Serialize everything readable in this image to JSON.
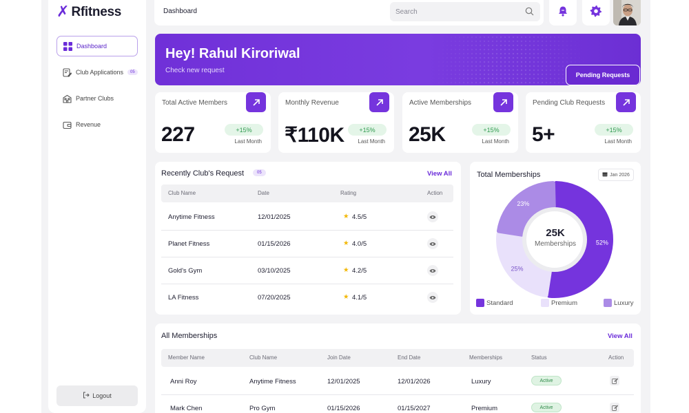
{
  "brand": {
    "logo_text": "Rfitness",
    "accent": "#7534dd"
  },
  "sidebar": {
    "items": [
      {
        "label": "Dashboard",
        "icon": "grid-icon",
        "active": true
      },
      {
        "label": "Club Applications",
        "icon": "document-edit-icon",
        "badge": "05"
      },
      {
        "label": "Partner Clubs",
        "icon": "building-icon"
      },
      {
        "label": "Revenue",
        "icon": "wallet-icon"
      }
    ],
    "logout_label": "Logout"
  },
  "header": {
    "title": "Dashboard",
    "search_placeholder": "Search"
  },
  "banner": {
    "greeting": "Hey! Rahul Kiroriwal",
    "subtitle": "Check new request",
    "button": "Pending Requests"
  },
  "stats": [
    {
      "label": "Total Active Members",
      "value": "227",
      "change": "+15%",
      "period": "Last Month"
    },
    {
      "label": "Monthly Revenue",
      "value": "₹110K",
      "change": "+15%",
      "period": "Last Month"
    },
    {
      "label": "Active Memberships",
      "value": "25K",
      "change": "+15%",
      "period": "Last Month"
    },
    {
      "label": "Pending Club Requests",
      "value": "5+",
      "change": "+15%",
      "period": "Last Month"
    }
  ],
  "requests": {
    "title": "Recently Club's Request",
    "badge": "05",
    "view_all": "View All",
    "columns": [
      "Club Name",
      "Date",
      "Rating",
      "Action"
    ],
    "rows": [
      {
        "club": "Anytime Fitness",
        "date": "12/01/2025",
        "rating": "4.5/5"
      },
      {
        "club": "Planet Fitness",
        "date": "01/15/2026",
        "rating": "4.0/5"
      },
      {
        "club": "Gold's Gym",
        "date": "03/10/2025",
        "rating": "4.2/5"
      },
      {
        "club": "LA Fitness",
        "date": "07/20/2025",
        "rating": "4.1/5"
      }
    ]
  },
  "memberships_chart": {
    "title": "Total Memberships",
    "date_label": "Jan 2026",
    "center_value": "25K",
    "center_label": "Memberships",
    "colors": {
      "standard": "#7534dd",
      "premium": "#e9e1fb",
      "luxury": "#ab8be6"
    }
  },
  "chart_data": {
    "type": "pie",
    "title": "Total Memberships",
    "categories": [
      "Standard",
      "Premium",
      "Luxury"
    ],
    "values": [
      52,
      25,
      23
    ],
    "labels": [
      "52%",
      "25%",
      "23%"
    ],
    "legend_position": "bottom"
  },
  "memberships": {
    "title": "All Memberships",
    "view_all": "View All",
    "columns": [
      "Member Name",
      "Club Name",
      "Join Date",
      "End Date",
      "Memberships",
      "Status",
      "Action"
    ],
    "rows": [
      {
        "member": "Anni Roy",
        "club": "Anytime Fitness",
        "join": "12/01/2025",
        "end": "12/01/2026",
        "type": "Luxury",
        "status": "Active"
      },
      {
        "member": "Mark Chen",
        "club": "Pro Gym",
        "join": "01/15/2026",
        "end": "01/15/2027",
        "type": "Premium",
        "status": "Active"
      }
    ]
  }
}
